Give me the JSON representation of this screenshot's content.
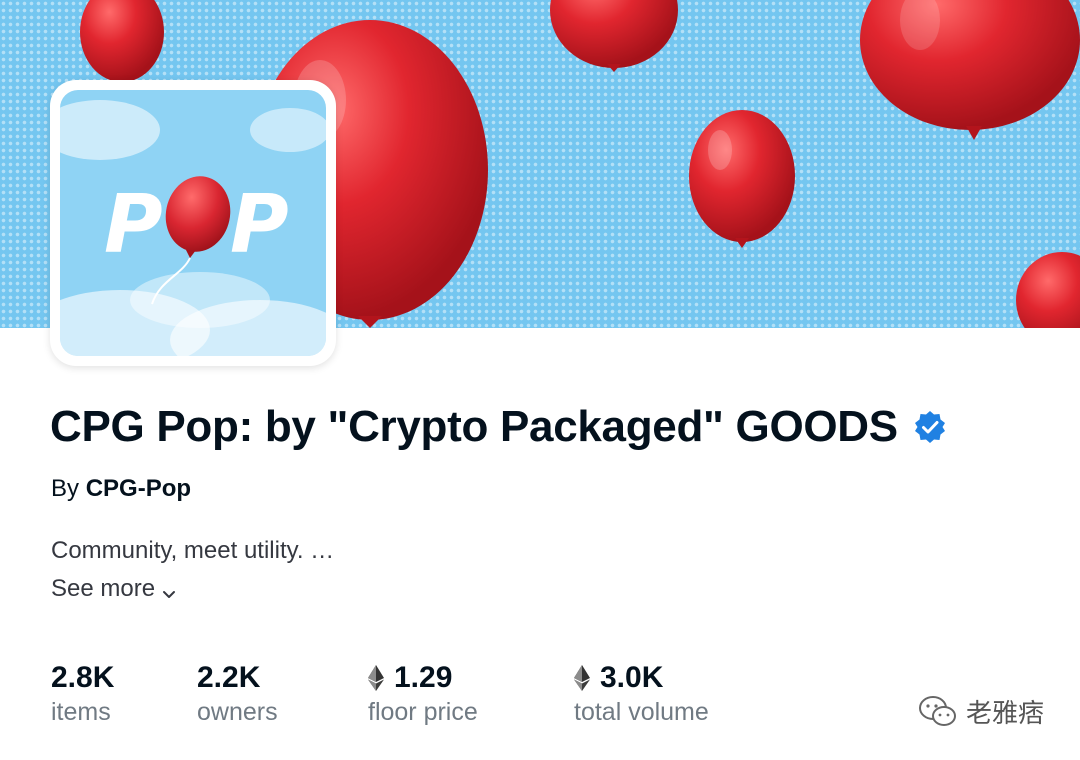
{
  "collection": {
    "title": "CPG Pop: by \"Crypto Packaged\" GOODS",
    "by_prefix": "By",
    "creator": "CPG-Pop",
    "description": "Community, meet utility. …",
    "see_more": "See more",
    "avatar_text": "POP",
    "verified_icon": "verified-badge-icon"
  },
  "stats": [
    {
      "value": "2.8K",
      "label": "items",
      "eth": false
    },
    {
      "value": "2.2K",
      "label": "owners",
      "eth": false
    },
    {
      "value": "1.29",
      "label": "floor price",
      "eth": true
    },
    {
      "value": "3.0K",
      "label": "total volume",
      "eth": true
    }
  ],
  "watermark": {
    "text": "老雅痞"
  },
  "colors": {
    "banner_blue": "#74c6f0",
    "balloon_red": "#e1262f",
    "verified_blue": "#2081e2",
    "text_dark": "#04111d",
    "text_gray": "#707a83"
  }
}
